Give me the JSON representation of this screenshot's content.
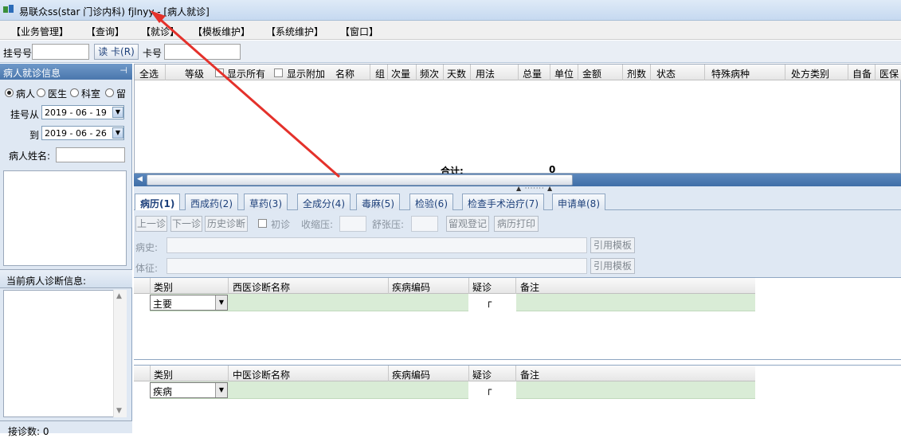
{
  "window": {
    "title": "易联众ss(star 门诊内科) fjlnyy - [病人就诊]"
  },
  "menu": [
    "【业务管理】",
    "【查询】",
    "【就诊】",
    "【模板维护】",
    "【系统维护】",
    "【窗口】"
  ],
  "toolbar": {
    "reg_no_label": "挂号号",
    "read_card_label": "读 卡(R)",
    "card_no_label": "卡号"
  },
  "left_panel": {
    "header": "病人就诊信息",
    "pin_icon": "pin-icon",
    "radios": [
      {
        "label": "病人",
        "checked": true
      },
      {
        "label": "医生",
        "checked": false
      },
      {
        "label": "科室",
        "checked": false
      },
      {
        "label": "留",
        "checked": false
      }
    ],
    "date_from_label": "挂号从",
    "date_from": "2019 - 06 - 19",
    "date_to_label": "到",
    "date_to": "2019 - 06 - 26",
    "patient_name_label": "病人姓名:",
    "current_diag_label": "当前病人诊断信息:",
    "visit_count": "接诊数: 0"
  },
  "rx_table": {
    "columns": [
      "全选",
      "等级",
      "显示所有",
      "显示附加",
      "名称",
      "组",
      "次量",
      "频次",
      "天数",
      "用法",
      "总量",
      "单位",
      "金额",
      "剂数",
      "状态",
      "特殊病种",
      "处方类别",
      "自备",
      "医保"
    ],
    "total_label": "合计:",
    "total_value": "0"
  },
  "tabs": [
    "病历(1)",
    "西成药(2)",
    "草药(3)",
    "全成分(4)",
    "毒麻(5)",
    "检验(6)",
    "检查手术治疗(7)",
    "申请单(8)"
  ],
  "emr": {
    "prev_btn": "上一诊",
    "next_btn": "下一诊",
    "history_btn": "历史诊断",
    "first_visit": "初诊",
    "systolic": "收缩压:",
    "diastolic": "舒张压:",
    "observe_btn": "留观登记",
    "print_btn": "病历打印",
    "history_label": "病史:",
    "exam_label": "体征:",
    "template_btn": "引用模板"
  },
  "western_grid": {
    "columns": [
      "类别",
      "西医诊断名称",
      "疾病编码",
      "疑诊",
      "备注"
    ],
    "row_type": "主要",
    "check_glyph": "┌"
  },
  "chinese_grid": {
    "columns": [
      "类别",
      "中医诊断名称",
      "疾病编码",
      "疑诊",
      "备注"
    ],
    "row_type": "疾病",
    "check_glyph": "┌"
  },
  "colors": {
    "accent": "#4a77ad",
    "arrow": "#e4312b",
    "row_green": "#d9ecd6"
  }
}
